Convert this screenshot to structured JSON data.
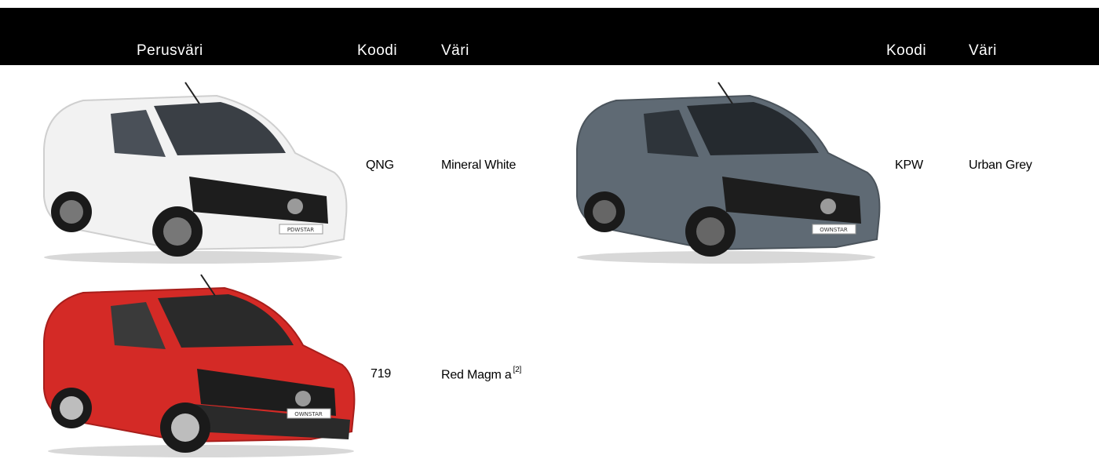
{
  "header": {
    "col_base_color": "Perusväri",
    "col_code_1": "Koodi",
    "col_color_1": "Väri",
    "col_code_2": "Koodi",
    "col_color_2": "Väri"
  },
  "rows": [
    {
      "code": "QNG",
      "color_name": "Mineral White",
      "footnote": "",
      "body_color": "#f2f2f2"
    },
    {
      "code": "KPW",
      "color_name": "Urban Grey",
      "footnote": "",
      "body_color": "#5f6a74"
    },
    {
      "code": "719",
      "color_name": "Red Magm a",
      "footnote": "[2]",
      "body_color": "#d42a26"
    }
  ],
  "plate_text": {
    "white": "PDWSTAR",
    "grey": "OWNSTAR",
    "red": "OWNSTAR"
  }
}
